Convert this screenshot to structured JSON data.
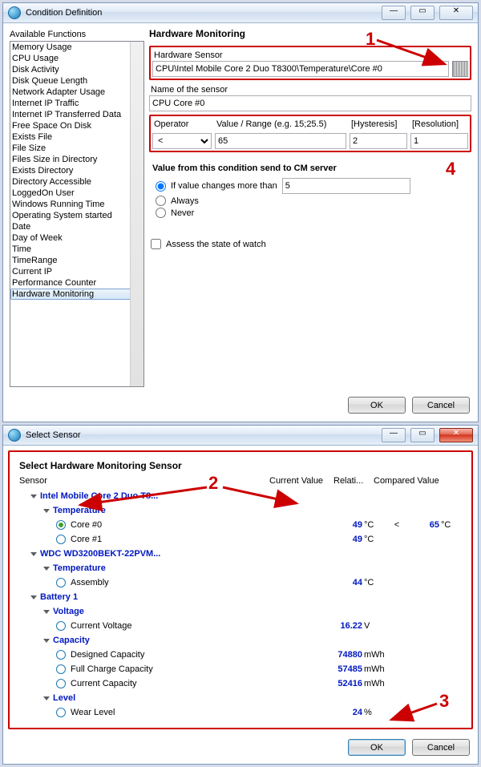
{
  "top": {
    "title": "Condition Definition",
    "availableLabel": "Available Functions",
    "heading": "Hardware Monitoring",
    "functions": [
      "Memory Usage",
      "CPU Usage",
      "Disk Activity",
      "Disk Queue Length",
      "Network Adapter Usage",
      "Internet IP Traffic",
      "Internet IP Transferred Data",
      "Free Space On Disk",
      "Exists File",
      "File Size",
      "Files Size in Directory",
      "Exists Directory",
      "Directory Accessible",
      "LoggedOn User",
      "Windows Running Time",
      "Operating System started",
      "Date",
      "Day of Week",
      "Time",
      "TimeRange",
      "Current IP",
      "Performance Counter",
      "Hardware Monitoring"
    ],
    "selectedFn": "Hardware Monitoring",
    "sensorLabel": "Hardware Sensor",
    "sensorValue": "CPU\\Intel Mobile Core 2 Duo T8300\\Temperature\\Core #0",
    "nameLabel": "Name of the sensor",
    "nameValue": "CPU Core #0",
    "opHeader": {
      "operator": "Operator",
      "value": "Value / Range (e.g. 15;25.5)",
      "hyst": "[Hysteresis]",
      "res": "[Resolution]"
    },
    "operator": "<",
    "value": "65",
    "hysteresis": "2",
    "resolution": "1",
    "sendLabel": "Value from this condition send to CM server",
    "radios": {
      "changes": "If value changes more than",
      "always": "Always",
      "never": "Never"
    },
    "changesVal": "5",
    "assess": "Assess the state of watch",
    "ok": "OK",
    "cancel": "Cancel"
  },
  "bottom": {
    "title": "Select Sensor",
    "heading": "Select Hardware Monitoring Sensor",
    "cols": {
      "sensor": "Sensor",
      "cur": "Current Value",
      "rel": "Relati...",
      "cmp": "Compared Value"
    },
    "tree": [
      {
        "type": "dev",
        "name": "Intel Mobile Core 2 Duo T8...",
        "depth": 1
      },
      {
        "type": "group",
        "name": "Temperature",
        "depth": 2
      },
      {
        "type": "item",
        "name": "Core #0",
        "depth": 3,
        "sel": true,
        "val": "49",
        "unit": "°C",
        "rel": "<",
        "cmp": "65",
        "cmpUnit": "°C"
      },
      {
        "type": "item",
        "name": "Core #1",
        "depth": 3,
        "val": "49",
        "unit": "°C"
      },
      {
        "type": "dev",
        "name": "WDC WD3200BEKT-22PVM...",
        "depth": 1
      },
      {
        "type": "group",
        "name": "Temperature",
        "depth": 2
      },
      {
        "type": "item",
        "name": "Assembly",
        "depth": 3,
        "val": "44",
        "unit": "°C"
      },
      {
        "type": "dev",
        "name": "Battery 1",
        "depth": 1
      },
      {
        "type": "group",
        "name": "Voltage",
        "depth": 2
      },
      {
        "type": "item",
        "name": "Current Voltage",
        "depth": 3,
        "val": "16.22",
        "unit": "V"
      },
      {
        "type": "group",
        "name": "Capacity",
        "depth": 2
      },
      {
        "type": "item",
        "name": "Designed Capacity",
        "depth": 3,
        "val": "74880",
        "unit": "mWh"
      },
      {
        "type": "item",
        "name": "Full Charge Capacity",
        "depth": 3,
        "val": "57485",
        "unit": "mWh"
      },
      {
        "type": "item",
        "name": "Current Capacity",
        "depth": 3,
        "val": "52416",
        "unit": "mWh"
      },
      {
        "type": "group",
        "name": "Level",
        "depth": 2
      },
      {
        "type": "item",
        "name": "Wear Level",
        "depth": 3,
        "val": "24",
        "unit": "%"
      }
    ],
    "ok": "OK",
    "cancel": "Cancel"
  },
  "annot": {
    "a1": "1",
    "a2": "2",
    "a3": "3",
    "a4": "4"
  }
}
